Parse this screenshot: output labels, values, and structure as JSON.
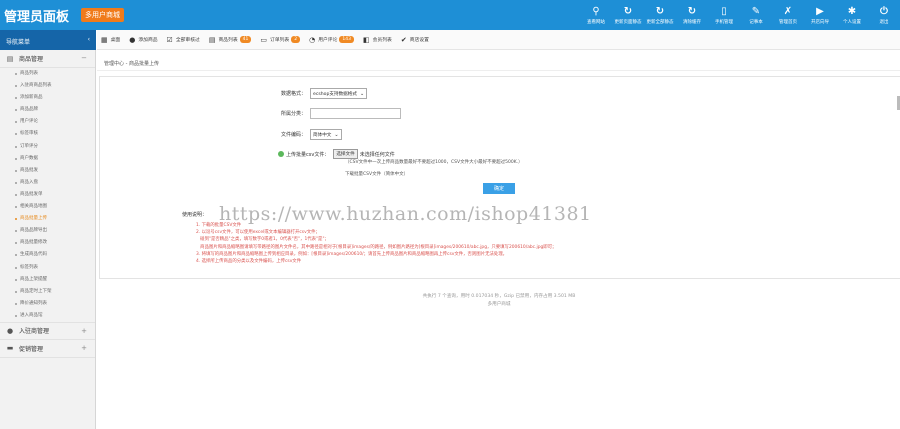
{
  "header": {
    "title": "管理员面板",
    "badge": "多用户商城",
    "nav": [
      {
        "icon": "search-icon",
        "glyph": "⚲",
        "label": "查看网站"
      },
      {
        "icon": "refresh-icon",
        "glyph": "↻",
        "label": "更新页面静态"
      },
      {
        "icon": "refresh-icon",
        "glyph": "↻",
        "label": "更新全部静态"
      },
      {
        "icon": "refresh-icon",
        "glyph": "↻",
        "label": "清除缓存"
      },
      {
        "icon": "phone-icon",
        "glyph": "▯",
        "label": "手机管理"
      },
      {
        "icon": "notebook-icon",
        "glyph": "✎",
        "label": "记事本"
      },
      {
        "icon": "wrench-icon",
        "glyph": "✗",
        "label": "管理首页"
      },
      {
        "icon": "play-icon",
        "glyph": "▶",
        "label": "开店向导"
      },
      {
        "icon": "gear-icon",
        "glyph": "✱",
        "label": "个人设置"
      },
      {
        "icon": "power-icon",
        "glyph": "⏻",
        "label": "退出"
      }
    ]
  },
  "sidebar": {
    "heading": "导航菜单",
    "heading_arrow": "‹",
    "groups": [
      {
        "label": "商品管理",
        "toggle": "−"
      },
      {
        "label": "入驻商管理",
        "toggle": "+"
      },
      {
        "label": "促销管理",
        "toggle": "+"
      }
    ],
    "items": [
      "商品列表",
      "入驻商商品列表",
      "添加新商品",
      "商品品牌",
      "用户评论",
      "标签审核",
      "订单评分",
      "商户数据",
      "商品批发",
      "商品入盘",
      "商品批发单",
      "相关商品地图",
      "商品批量上传",
      "商品品牌导出",
      "商品批量修改",
      "生成商品代码",
      "标签列表",
      "商品上架提醒",
      "商品定时上下架",
      "降价通知列表",
      "进入商品馆"
    ],
    "active_index": 12
  },
  "toolbar": {
    "items": [
      {
        "icon": "grid-icon",
        "glyph": "▦",
        "label": "桌面",
        "badge": ""
      },
      {
        "icon": "plus-circle-icon",
        "glyph": "●",
        "label": "添加商品",
        "badge": ""
      },
      {
        "icon": "check-icon",
        "glyph": "☑",
        "label": "全部审核过",
        "badge": ""
      },
      {
        "icon": "list-icon",
        "glyph": "▤",
        "label": "商品列表",
        "badge": "41"
      },
      {
        "icon": "doc-icon",
        "glyph": "▭",
        "label": "订单列表",
        "badge": "2"
      },
      {
        "icon": "comment-icon",
        "glyph": "◔",
        "label": "用户评论",
        "badge": "143"
      },
      {
        "icon": "member-icon",
        "glyph": "◧",
        "label": "会员列表",
        "badge": ""
      },
      {
        "icon": "settings-icon",
        "glyph": "✔",
        "label": "商店设置",
        "badge": ""
      }
    ]
  },
  "content": {
    "breadcrumb": "管理中心 - 商品批量上传",
    "form": {
      "data_format_label": "数据格式：",
      "data_format_value": "ecshop支持数据格式",
      "category_label": "所属分类：",
      "encoding_label": "文件编码：",
      "encoding_value": "简体中文",
      "upload_label": "上传批量csv文件：",
      "file_button": "选择文件",
      "file_status": "未选择任何文件",
      "file_note": "（CSV文件中一次上传商品数量最好不要超过1000，CSV文件大小最好不要超过500K.）",
      "download_note": "下载批量CSV文件（简体中文）",
      "submit": "确定"
    },
    "help_title": "使用说明：",
    "help_lines": [
      "1. 下载的批量CSV文件",
      "2. 以逗号csv文件，可以使用excel或文本编辑器打开csv文件；",
      "   碰到\"是否精品\"之类，填写数字0或者1，0代表\"否\"，1代表\"是\"；",
      "   商品图片和商品缩略图请填写带路径的图片文件名，其中路径是相对于[根目录]images/的路径，例如图片路径为[根目录]images/200610/abc.jpg，只要填写200610/abc.jpg即可；",
      "3. 将填写的商品图片和商品缩略图上传到相应目录，例如：[根目录]images/200610/；请首先上传商品图片和商品缩略图再上传csv文件，否则图片无法处理。",
      "4. 选择所上传商品的分类以及文件编码，上传csv文件"
    ],
    "watermark": "https://www.huzhan.com/ishop41381",
    "footer_line1": "共执行 7 个查询，用时 0.017034 秒，Gzip 已禁用，内存占用 3.501 MB",
    "footer_line2": "多用户商城"
  }
}
